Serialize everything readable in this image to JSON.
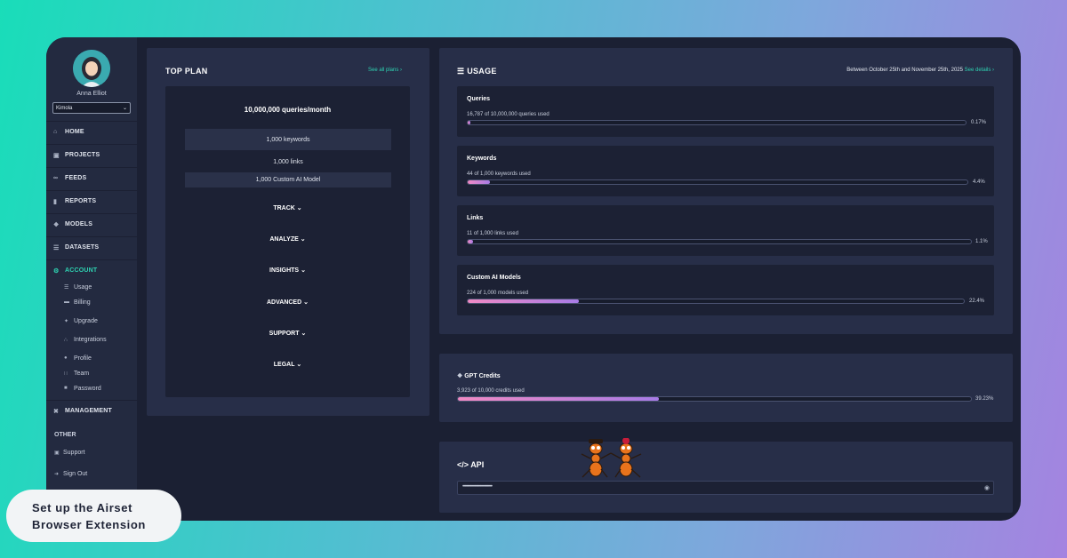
{
  "sidebar": {
    "user_name": "Anna Elliot",
    "org_select": "Kimola",
    "nav": [
      {
        "label": "HOME",
        "icon": "home-icon"
      },
      {
        "label": "PROJECTS",
        "icon": "folder-icon"
      },
      {
        "label": "FEEDS",
        "icon": "feed-icon"
      },
      {
        "label": "REPORTS",
        "icon": "bar-chart-icon"
      },
      {
        "label": "MODELS",
        "icon": "model-icon"
      },
      {
        "label": "DATASETS",
        "icon": "layers-icon"
      },
      {
        "label": "ACCOUNT",
        "icon": "account-icon"
      }
    ],
    "account_sub": [
      {
        "label": "Usage",
        "icon": "usage-icon"
      },
      {
        "label": "Billing",
        "icon": "billing-icon"
      },
      {
        "label": "Upgrade",
        "icon": "upgrade-icon"
      },
      {
        "label": "Integrations",
        "icon": "integrations-icon"
      },
      {
        "label": "Profile",
        "icon": "profile-icon"
      },
      {
        "label": "Team",
        "icon": "team-icon"
      },
      {
        "label": "Password",
        "icon": "lock-icon"
      }
    ],
    "management": "MANAGEMENT",
    "other_label": "OTHER",
    "support": "Support",
    "sign_out": "Sign Out"
  },
  "top_plan": {
    "title": "TOP PLAN",
    "see_all": "See all plans",
    "headline": "10,000,000 queries/month",
    "rows": [
      "1,000 keywords",
      "1,000 links",
      "1,000 Custom AI Model"
    ],
    "sections": [
      "TRACK",
      "ANALYZE",
      "INSIGHTS",
      "ADVANCED",
      "SUPPORT",
      "LEGAL"
    ]
  },
  "usage": {
    "title": "USAGE",
    "range": "Between October 25th and November 25th, 2025",
    "see_details": "See details",
    "cards": [
      {
        "title": "Queries",
        "subtitle": "16,787 of 10,000,000 queries used",
        "percent_label": "0.17%",
        "fraction": 0.0017
      },
      {
        "title": "Keywords",
        "subtitle": "44 of 1,000 keywords used",
        "percent_label": "4.4%",
        "fraction": 0.044
      },
      {
        "title": "Links",
        "subtitle": "11 of 1,000 links used",
        "percent_label": "1.1%",
        "fraction": 0.011
      },
      {
        "title": "Custom AI Models",
        "subtitle": "224 of 1,000 models used",
        "percent_label": "22.4%",
        "fraction": 0.224
      }
    ]
  },
  "gpt": {
    "title": "GPT Credits",
    "subtitle": "3,923 of 10,000 credits used",
    "percent_label": "39.23%",
    "fraction": 0.3923
  },
  "api": {
    "title": "API",
    "key_masked": "••••••••••••••••••••••••••••••"
  },
  "banner": {
    "line1": "Set up the Airset",
    "line2": "Browser Extension"
  },
  "colors": {
    "accent": "#2ed3b2",
    "fill_start": "#f08ac4",
    "fill_end": "#a77be6"
  }
}
